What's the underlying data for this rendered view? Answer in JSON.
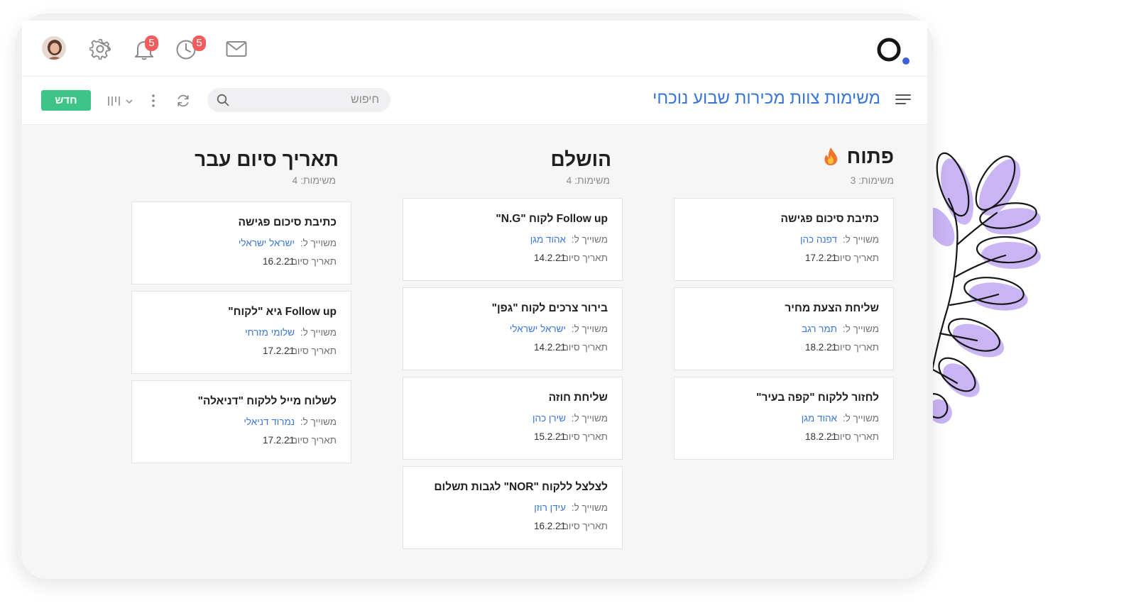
{
  "header": {
    "notifications_count": "5",
    "reminders_count": "5"
  },
  "toolbar": {
    "title": "משימות צוות מכירות שבוע נוכחי",
    "search_placeholder": "חיפוש",
    "new_label": "חדש"
  },
  "labels": {
    "assigned_to": "משוייך ל:",
    "due_date": "תאריך סיום:"
  },
  "columns": [
    {
      "title": "פתוח",
      "count_text": "משימות: 3",
      "icon": "fire-icon",
      "cards": [
        {
          "title": "כתיבת סיכום פגישה",
          "assignee": "דפנה כהן",
          "date": "17.2.21"
        },
        {
          "title": "שליחת הצעת מחיר",
          "assignee": "תמר רגב",
          "date": "18.2.21"
        },
        {
          "title": "לחזור ללקוח \"קפה בעיר\"",
          "assignee": "אהוד מגן",
          "date": "18.2.21"
        }
      ]
    },
    {
      "title": "הושלם",
      "count_text": "משימות: 4",
      "cards": [
        {
          "title": "Follow up לקוח  \"N.G\"",
          "assignee": "אהוד מגן",
          "date": "14.2.21"
        },
        {
          "title": "בירור צרכים לקוח \"גפן\"",
          "assignee": "ישראל ישראלי",
          "date": "14.2.21"
        },
        {
          "title": "שליחת חוזה",
          "assignee": "שירן כהן",
          "date": "15.2.21"
        },
        {
          "title": "לצלצל ללקוח \"NOR\" לגבות תשלום",
          "assignee": "עידן רוזן",
          "date": "16.2.21"
        }
      ]
    },
    {
      "title": "תאריך סיום עבר",
      "count_text": "משימות: 4",
      "cards": [
        {
          "title": "כתיבת סיכום פגישה",
          "assignee": "ישראל ישראלי",
          "date": "16.2.21"
        },
        {
          "title": "Follow up גיא \"לקוח\"",
          "assignee": "שלומי מזרחי",
          "date": "17.2.21"
        },
        {
          "title": "לשלוח מייל ללקוח \"דניאלה\"",
          "assignee": "נמרוד דניאלי",
          "date": "17.2.21"
        }
      ]
    }
  ],
  "colors": {
    "accent_blue": "#3a76d8",
    "new_button_green": "#3ec486",
    "badge_red": "#f25c5c",
    "leaf_purple": "#c9b4f4"
  }
}
